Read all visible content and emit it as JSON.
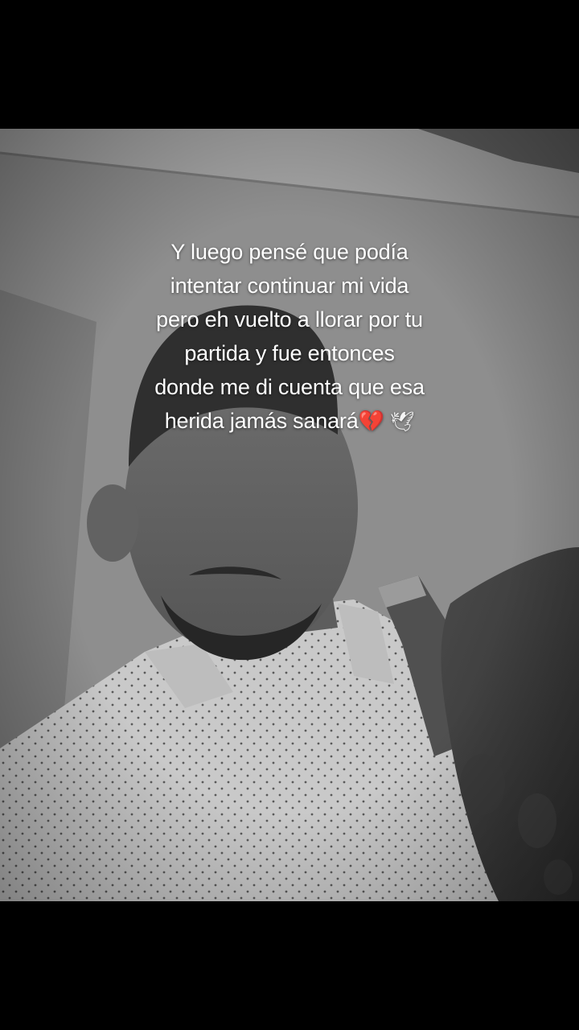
{
  "caption": {
    "lines": [
      "Y luego pensé que podía",
      "intentar continuar mi vida",
      "pero eh vuelto a llorar por tu",
      "partida y fue entonces",
      "donde me di cuenta que esa",
      "herida jamás sanará"
    ],
    "emoji": {
      "broken_heart": "💔",
      "dove": "🕊"
    }
  },
  "colors": {
    "background": "#000000",
    "caption_text": "#ffffff",
    "heart": "#e8306a"
  },
  "icons": [
    "broken-heart-icon",
    "dove-icon"
  ]
}
